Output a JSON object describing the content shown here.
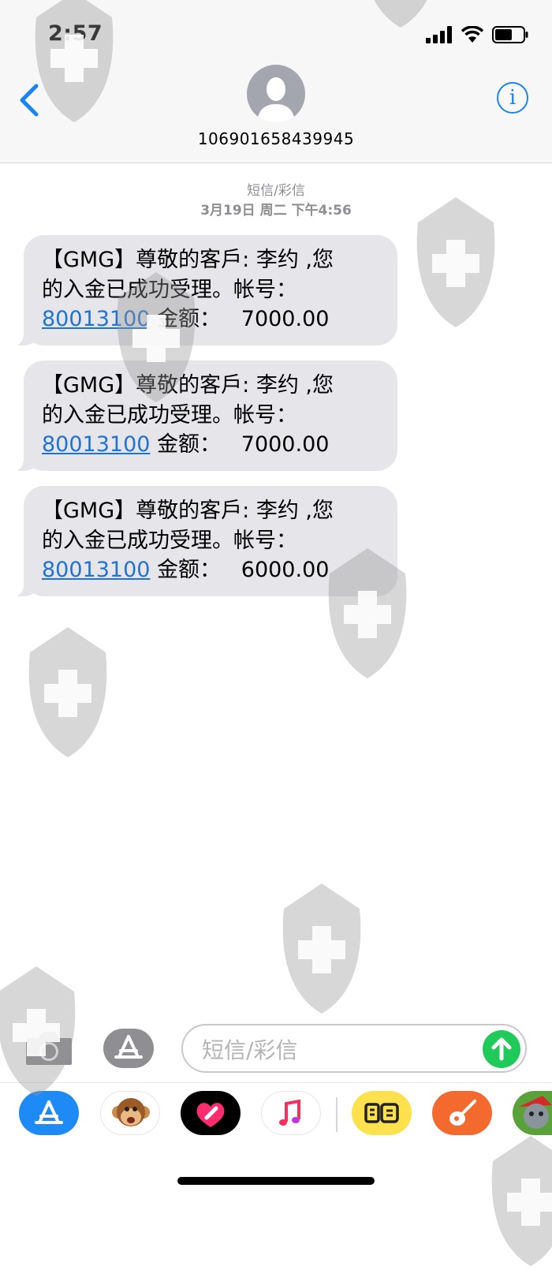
{
  "status_bar": {
    "time": "2:57",
    "icons": [
      "signal-icon",
      "wifi-icon",
      "battery-icon"
    ]
  },
  "header": {
    "contact": "106901658439945",
    "back_icon": "chevron-left-icon",
    "info_icon": "info-icon",
    "avatar_icon": "person-silhouette-icon"
  },
  "conversation": {
    "channel_label": "短信/彩信",
    "timestamp": "3月19日 周二 下午4:56",
    "messages": [
      {
        "line1": "【GMG】尊敬的客戶: 李约 ,您",
        "line2": "的入金已成功受理。帐号：",
        "account": "80013100",
        "amount_text": " 金额：   7000.00"
      },
      {
        "line1": "【GMG】尊敬的客戶: 李约 ,您",
        "line2": "的入金已成功受理。帐号：",
        "account": "80013100",
        "amount_text": " 金额：   7000.00"
      },
      {
        "line1": "【GMG】尊敬的客戶: 李约 ,您",
        "line2": "的入金已成功受理。帐号：",
        "account": "80013100",
        "amount_text": " 金额：   6000.00"
      }
    ]
  },
  "composer": {
    "placeholder": "短信/彩信",
    "value": "",
    "camera_icon": "camera-icon",
    "apps_icon": "app-store-icon",
    "send_icon": "send-arrow-icon"
  },
  "app_drawer": [
    "app-store-icon",
    "animoji-monkey-icon",
    "digital-touch-heart-icon",
    "music-note-icon",
    "xianyu-icon",
    "guitar-icon",
    "talking-tom-icon"
  ],
  "watermark": "shield-cross-watermark-icon",
  "colors": {
    "accent": "#1a84f2",
    "bubble": "#e5e5ea",
    "link": "#1f74d3",
    "send": "#1fc95a",
    "meta": "#8e8e93"
  }
}
